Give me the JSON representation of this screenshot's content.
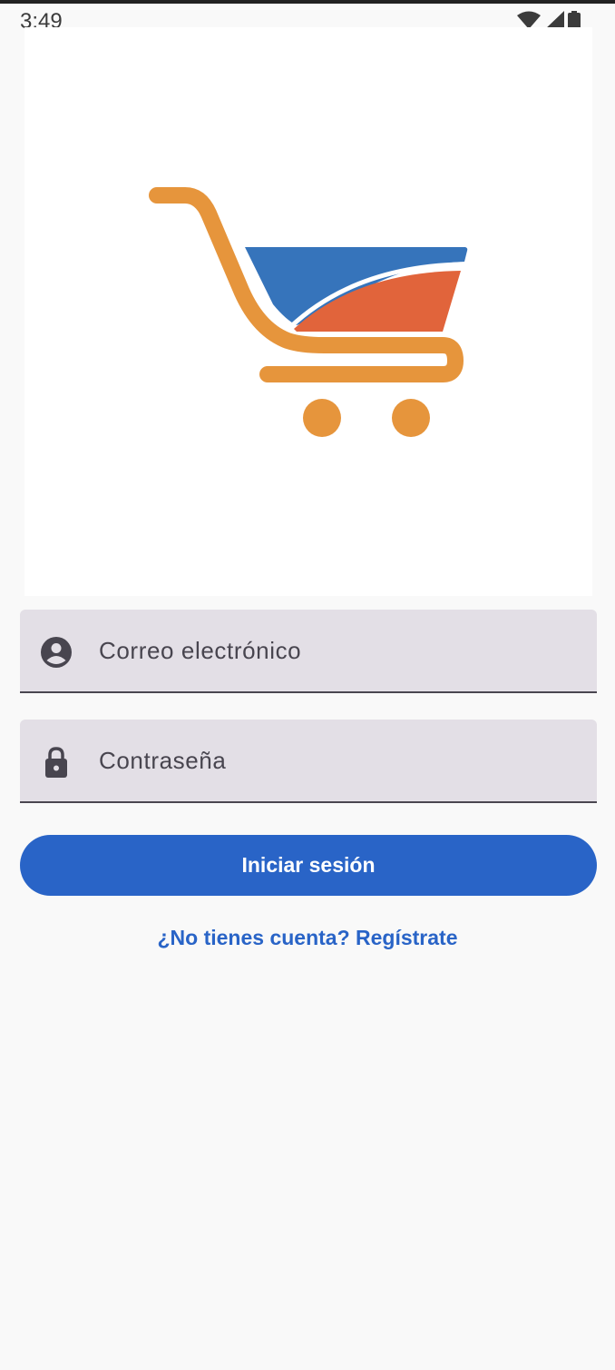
{
  "status_bar": {
    "time": "3:49",
    "icons": [
      "wifi-icon",
      "signal-icon",
      "battery-icon"
    ]
  },
  "logo": {
    "icon": "shopping-cart-icon",
    "colors": {
      "cart_frame": "#e6953c",
      "basket_blue": "#3674bb",
      "basket_orange": "#e1643b"
    }
  },
  "form": {
    "email": {
      "placeholder": "Correo electrónico",
      "value": "",
      "icon": "account-circle-icon"
    },
    "password": {
      "placeholder": "Contraseña",
      "value": "",
      "icon": "lock-icon"
    }
  },
  "actions": {
    "login_label": "Iniciar sesión",
    "register_label": "¿No tienes cuenta? Regístrate"
  },
  "colors": {
    "primary": "#2964c7",
    "background": "#f9f9f9",
    "field_background": "#e3dfe6"
  }
}
